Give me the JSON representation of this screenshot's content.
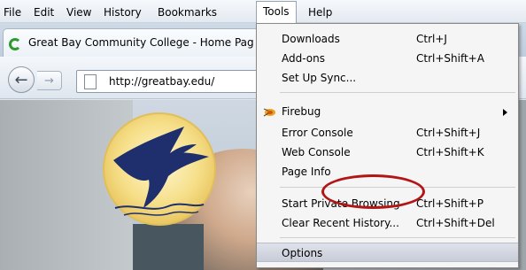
{
  "menubar": {
    "file": "File",
    "edit": "Edit",
    "view": "View",
    "history": "History",
    "bookmarks": "Bookmarks",
    "tools": "Tools",
    "help": "Help"
  },
  "tab": {
    "title": "Great Bay Community College - Home Pag",
    "icon": "loading-spinner-icon"
  },
  "navbar": {
    "back_icon": "←",
    "forward_icon": "→",
    "url": "http://greatbay.edu/"
  },
  "tools_menu": {
    "items": [
      {
        "label": "Downloads",
        "shortcut": "Ctrl+J"
      },
      {
        "label": "Add-ons",
        "shortcut": "Ctrl+Shift+A"
      },
      {
        "label": "Set Up Sync...",
        "shortcut": ""
      },
      {
        "label": "Firebug",
        "shortcut": ""
      },
      {
        "label": "Error Console",
        "shortcut": "Ctrl+Shift+J"
      },
      {
        "label": "Web Console",
        "shortcut": "Ctrl+Shift+K"
      },
      {
        "label": "Page Info",
        "shortcut": ""
      },
      {
        "label": "Start Private Browsing",
        "shortcut": "Ctrl+Shift+P"
      },
      {
        "label": "Clear Recent History...",
        "shortcut": "Ctrl+Shift+Del"
      },
      {
        "label": "Options",
        "shortcut": ""
      }
    ]
  },
  "colors": {
    "annotation": "#b21515",
    "heron": "#1f2f6e",
    "logo_sun": "#f6df8a"
  }
}
